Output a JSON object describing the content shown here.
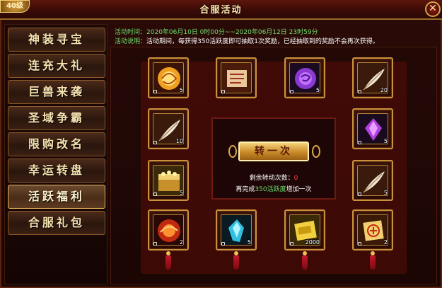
{
  "window": {
    "title": "合服活动",
    "level_badge": "40级",
    "close_label": "✕"
  },
  "sidebar": {
    "items": [
      {
        "label": "神装寻宝",
        "active": false
      },
      {
        "label": "连充大礼",
        "active": false
      },
      {
        "label": "巨兽来袭",
        "active": false
      },
      {
        "label": "圣域争霸",
        "active": false
      },
      {
        "label": "限购改名",
        "active": false
      },
      {
        "label": "幸运转盘",
        "active": false
      },
      {
        "label": "活跃福利",
        "active": true
      },
      {
        "label": "合服礼包",
        "active": false
      }
    ]
  },
  "info": {
    "time_label": "活动时间：",
    "time_value": "2020年06月10日  0时00分~~2020年06月12日  23时59分",
    "desc_label": "活动说明：",
    "desc_value": "活动期间，每获得350活跃度即可抽取1次奖励，已经抽取到的奖励不会再次获得。"
  },
  "rewards": [
    {
      "icon": "golden-swirl-orb-icon",
      "count": "5"
    },
    {
      "icon": "scroll-icon",
      "count": ""
    },
    {
      "icon": "purple-rose-gem-icon",
      "count": "5"
    },
    {
      "icon": "white-feather-icon",
      "count": "20"
    },
    {
      "icon": "white-feather-icon",
      "count": "10"
    },
    {
      "icon": "purple-crystal-icon",
      "count": "5"
    },
    {
      "icon": "treasure-chest-icon",
      "count": "5"
    },
    {
      "icon": "white-feather-icon",
      "count": "5"
    },
    {
      "icon": "red-orb-icon",
      "count": "2"
    },
    {
      "icon": "blue-crystal-icon",
      "count": "5"
    },
    {
      "icon": "gold-ingot-icon",
      "count": "2000"
    },
    {
      "icon": "protect-charm-icon",
      "count": "2"
    }
  ],
  "draw": {
    "button_label": "转一次",
    "remaining_label": "剩余转动次数：",
    "remaining_count": "0",
    "hint_prefix": "再完成",
    "hint_highlight": "350活跃度",
    "hint_suffix": "增加一次"
  },
  "colors": {
    "accent_gold": "#e8b75a",
    "highlight_green": "#6fe06f",
    "count_red": "#ff4a3a"
  }
}
